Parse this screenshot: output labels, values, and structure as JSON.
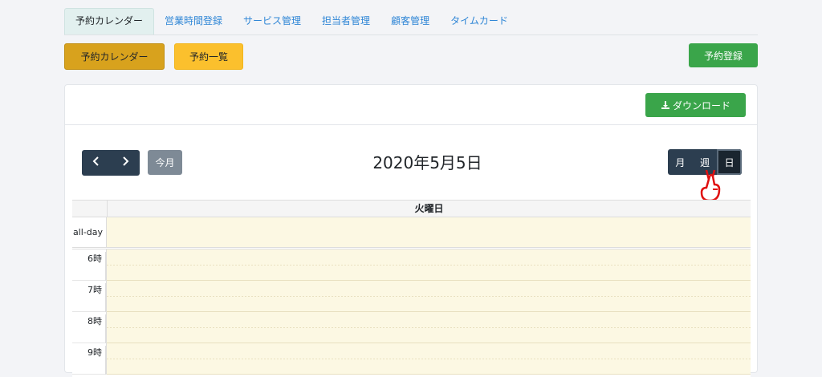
{
  "tabs": [
    {
      "label": "予約カレンダー",
      "active": true
    },
    {
      "label": "営業時間登録"
    },
    {
      "label": "サービス管理"
    },
    {
      "label": "担当者管理"
    },
    {
      "label": "顧客管理"
    },
    {
      "label": "タイムカード"
    }
  ],
  "actions": {
    "calendar_label": "予約カレンダー",
    "list_label": "予約一覧",
    "register_label": "予約登録"
  },
  "card": {
    "download_label": "ダウンロード",
    "download_icon": "download-icon"
  },
  "calendar": {
    "prev_icon": "chevron-left-icon",
    "next_icon": "chevron-right-icon",
    "today_label": "今月",
    "title": "2020年5月5日",
    "views": {
      "month": "月",
      "week": "週",
      "day": "日"
    },
    "active_view": "day",
    "day_header": "火曜日",
    "allday_label": "all-day",
    "hours": [
      "6時",
      "7時",
      "8時",
      "9時"
    ]
  },
  "colors": {
    "today_bg": "#fcf8e3",
    "primary_dark": "#2c3e50",
    "success": "#3aa54a",
    "warning": "#fbc02d"
  }
}
